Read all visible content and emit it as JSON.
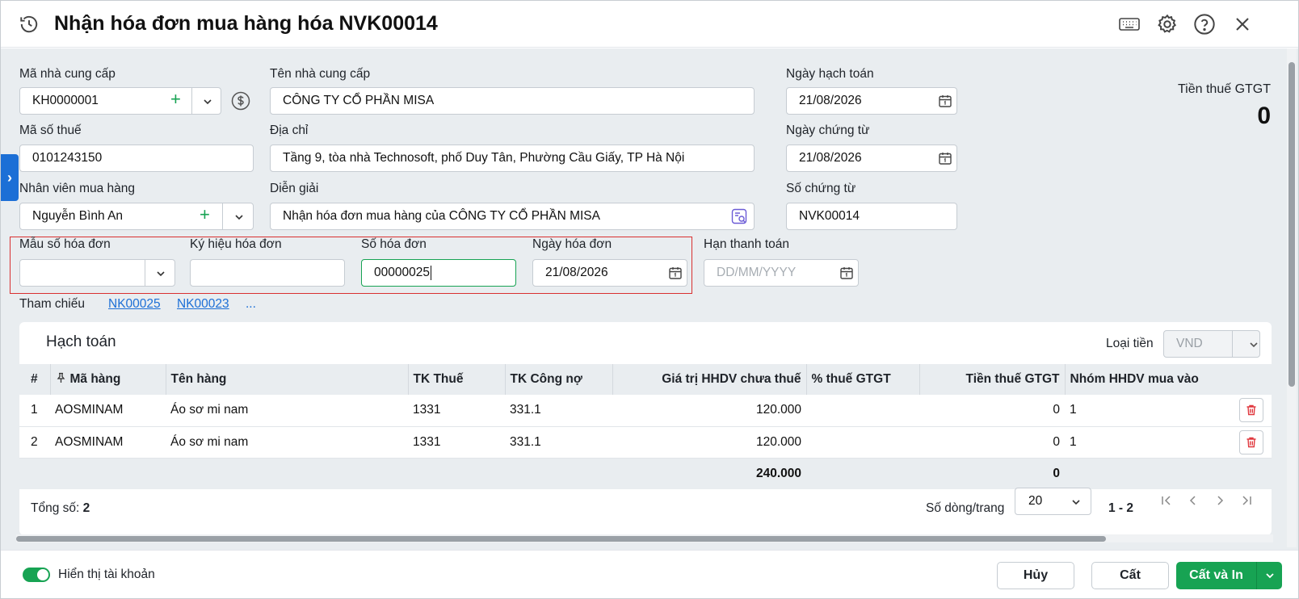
{
  "header": {
    "title": "Nhận hóa đơn mua hàng hóa NVK00014"
  },
  "form": {
    "supplier_code": {
      "label": "Mã nhà cung cấp",
      "value": "KH0000001"
    },
    "supplier_name": {
      "label": "Tên nhà cung cấp",
      "value": "CÔNG TY CỔ PHẦN MISA"
    },
    "tax_code": {
      "label": "Mã số thuế",
      "value": "0101243150"
    },
    "address": {
      "label": "Địa chỉ",
      "value": "Tầng 9, tòa nhà Technosoft, phố Duy Tân, Phường Cầu Giấy, TP Hà Nội"
    },
    "buyer": {
      "label": "Nhân viên mua hàng",
      "value": "Nguyễn Bình An"
    },
    "description": {
      "label": "Diễn giải",
      "value": "Nhận hóa đơn mua hàng của CÔNG TY CỔ PHẦN MISA"
    },
    "posting_date": {
      "label": "Ngày hạch toán",
      "value": "21/08/2026"
    },
    "voucher_date": {
      "label": "Ngày chứng từ",
      "value": "21/08/2026"
    },
    "voucher_no": {
      "label": "Số chứng từ",
      "value": "NVK00014"
    },
    "invoice_template": {
      "label": "Mẫu số hóa đơn",
      "value": ""
    },
    "invoice_symbol": {
      "label": "Ký hiệu hóa đơn",
      "value": ""
    },
    "invoice_no": {
      "label": "Số hóa đơn",
      "value": "00000025"
    },
    "invoice_date": {
      "label": "Ngày hóa đơn",
      "value": "21/08/2026"
    },
    "due_date": {
      "label": "Hạn thanh toán",
      "placeholder": "DD/MM/YYYY"
    },
    "reference": {
      "label": "Tham chiếu",
      "links": [
        "NK00025",
        "NK00023"
      ],
      "more": "..."
    }
  },
  "vat_summary": {
    "label": "Tiền thuế GTGT",
    "value": "0"
  },
  "accounting": {
    "title": "Hạch toán",
    "currency_label": "Loại tiền",
    "currency_value": "VND",
    "columns": [
      "#",
      "Mã hàng",
      "Tên hàng",
      "TK Thuế",
      "TK Công nợ",
      "Giá trị HHDV chưa thuế",
      "% thuế GTGT",
      "Tiền thuế GTGT",
      "Nhóm HHDV mua vào"
    ],
    "rows": [
      {
        "no": "1",
        "code": "AOSMINAM",
        "name": "Áo sơ mi nam",
        "tax_acc": "1331",
        "debt_acc": "331.1",
        "amount": "120.000",
        "vat_rate": "",
        "vat_amount": "0",
        "group": "1"
      },
      {
        "no": "2",
        "code": "AOSMINAM",
        "name": "Áo sơ mi nam",
        "tax_acc": "1331",
        "debt_acc": "331.1",
        "amount": "120.000",
        "vat_rate": "",
        "vat_amount": "0",
        "group": "1"
      }
    ],
    "totals": {
      "amount": "240.000",
      "vat_amount": "0"
    },
    "total_label": "Tổng số:",
    "total_count": "2",
    "rows_per_page_label": "Số dòng/trang",
    "rows_per_page": "20",
    "range": "1 - 2"
  },
  "footer": {
    "toggle_label": "Hiển thị tài khoản",
    "cancel": "Hủy",
    "save": "Cất",
    "save_print": "Cất và In"
  },
  "colors": {
    "accent_green": "#17a353",
    "link_blue": "#1c6fd6",
    "highlight_red": "#d93030"
  }
}
